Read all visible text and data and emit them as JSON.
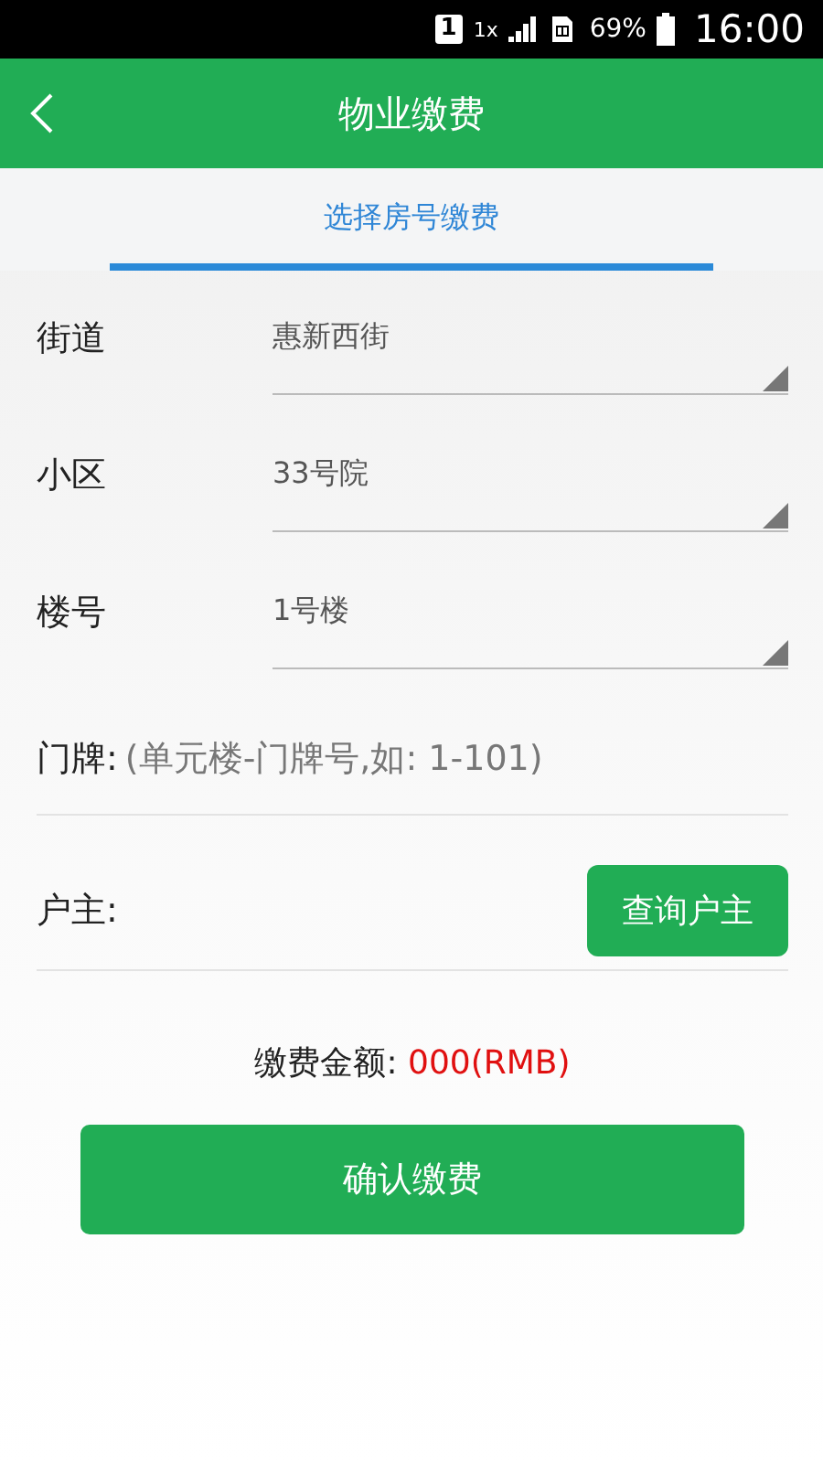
{
  "status_bar": {
    "sim_slot": "1",
    "network": "1x",
    "battery": "69%",
    "time": "16:00"
  },
  "header": {
    "title": "物业缴费"
  },
  "tabs": [
    {
      "label": "选择房号缴费",
      "selected": true
    }
  ],
  "selects": [
    {
      "label": "街道",
      "value": "惠新西街"
    },
    {
      "label": "小区",
      "value": "33号院"
    },
    {
      "label": "楼号",
      "value": "1号楼"
    }
  ],
  "door_plate": {
    "label": "门牌:",
    "placeholder": "(单元楼-门牌号,如: 1-101)"
  },
  "owner": {
    "label": "户主:",
    "button": "查询户主"
  },
  "amount": {
    "label": "缴费金额:",
    "value": "000(RMB)"
  },
  "confirm_button": "确认缴费"
}
